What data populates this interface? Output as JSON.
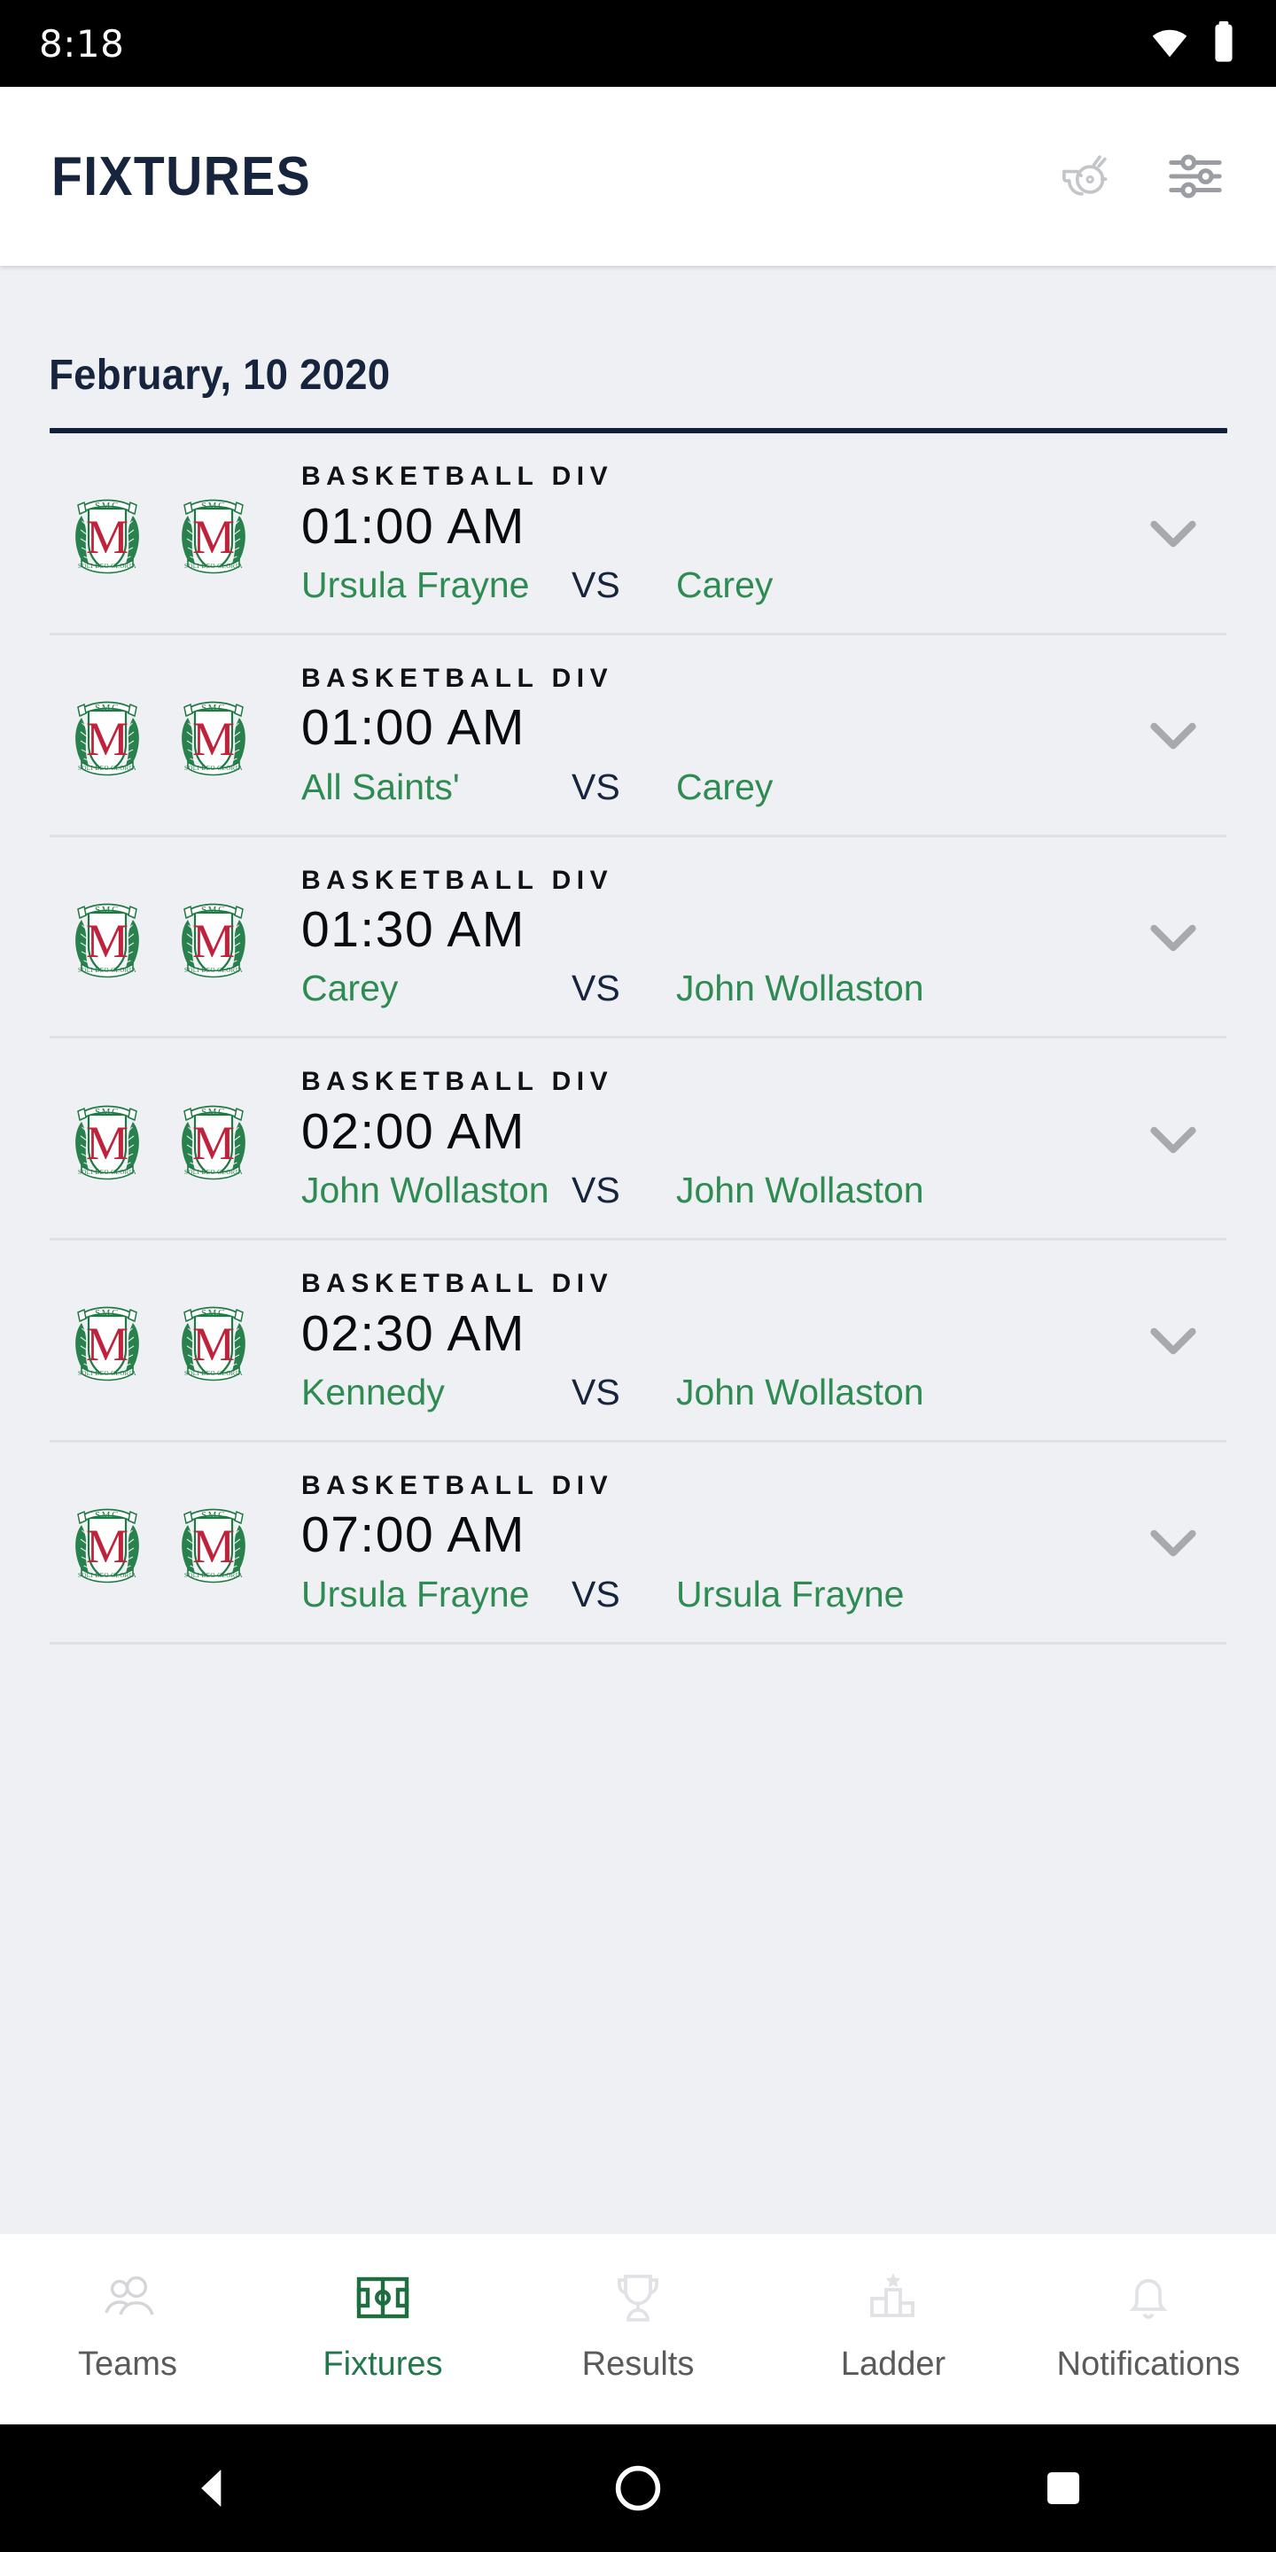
{
  "status_bar": {
    "time": "8:18",
    "icons": [
      "wifi-icon",
      "battery-icon"
    ]
  },
  "app_bar": {
    "title": "FIXTURES",
    "actions": [
      {
        "name": "whistle-icon",
        "label": "Whistle"
      },
      {
        "name": "filter-icon",
        "label": "Filter"
      }
    ]
  },
  "main": {
    "date_header": "February, 10 2020",
    "vs_label": "VS",
    "fixtures": [
      {
        "division": "BASKETBALL DIV",
        "time": "01:00 AM",
        "team_home": "Ursula Frayne",
        "team_away": "Carey",
        "expand_icon": "chevron-down-icon"
      },
      {
        "division": "BASKETBALL DIV",
        "time": "01:00 AM",
        "team_home": "All Saints'",
        "team_away": "Carey",
        "expand_icon": "chevron-down-icon"
      },
      {
        "division": "BASKETBALL DIV",
        "time": "01:30 AM",
        "team_home": "Carey",
        "team_away": "John Wollaston",
        "expand_icon": "chevron-down-icon"
      },
      {
        "division": "BASKETBALL DIV",
        "time": "02:00 AM",
        "team_home": "John Wollaston",
        "team_away": "John Wollaston",
        "expand_icon": "chevron-down-icon"
      },
      {
        "division": "BASKETBALL DIV",
        "time": "02:30 AM",
        "team_home": "Kennedy",
        "team_away": "John Wollaston",
        "expand_icon": "chevron-down-icon"
      },
      {
        "division": "BASKETBALL DIV",
        "time": "07:00 AM",
        "team_home": "Ursula Frayne",
        "team_away": "Ursula Frayne",
        "expand_icon": "chevron-down-icon"
      }
    ],
    "crest": {
      "top_text": "SMC",
      "monogram": "M",
      "bottom_text": "SOLI DEO GLORIA"
    }
  },
  "bottom_nav": {
    "items": [
      {
        "label": "Teams",
        "icon": "people-icon",
        "active": false
      },
      {
        "label": "Fixtures",
        "icon": "pitch-icon",
        "active": true
      },
      {
        "label": "Results",
        "icon": "trophy-icon",
        "active": false
      },
      {
        "label": "Ladder",
        "icon": "podium-star-icon",
        "active": false
      },
      {
        "label": "Notifications",
        "icon": "bell-icon",
        "active": false
      }
    ]
  },
  "android_nav": {
    "buttons": [
      {
        "name": "back-button",
        "icon": "triangle-left-icon"
      },
      {
        "name": "home-button",
        "icon": "circle-icon"
      },
      {
        "name": "recents-button",
        "icon": "square-icon"
      }
    ]
  },
  "colors": {
    "navy": "#16243d",
    "green": "#2e8b52",
    "active_green": "#21764a",
    "background": "#eff0f4",
    "surface": "#ffffff",
    "divider": "#dfe1e6",
    "crest_green": "#1e7a43",
    "crest_red": "#c0223b"
  }
}
